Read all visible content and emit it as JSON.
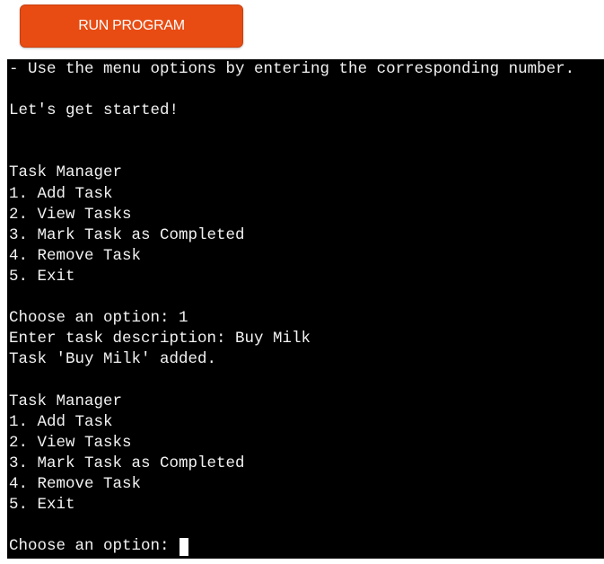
{
  "run_button": {
    "label": "RUN PROGRAM"
  },
  "terminal": {
    "lines": [
      "- Use the menu options by entering the corresponding number.",
      "",
      "Let's get started!",
      "",
      "",
      "Task Manager",
      "1. Add Task",
      "2. View Tasks",
      "3. Mark Task as Completed",
      "4. Remove Task",
      "5. Exit",
      "",
      "Choose an option: 1",
      "Enter task description: Buy Milk",
      "Task 'Buy Milk' added.",
      "",
      "Task Manager",
      "1. Add Task",
      "2. View Tasks",
      "3. Mark Task as Completed",
      "4. Remove Task",
      "5. Exit",
      ""
    ],
    "prompt": "Choose an option: "
  },
  "colors": {
    "button_bg": "#e84c13",
    "terminal_bg": "#000000",
    "terminal_text": "#f2f2f2"
  }
}
